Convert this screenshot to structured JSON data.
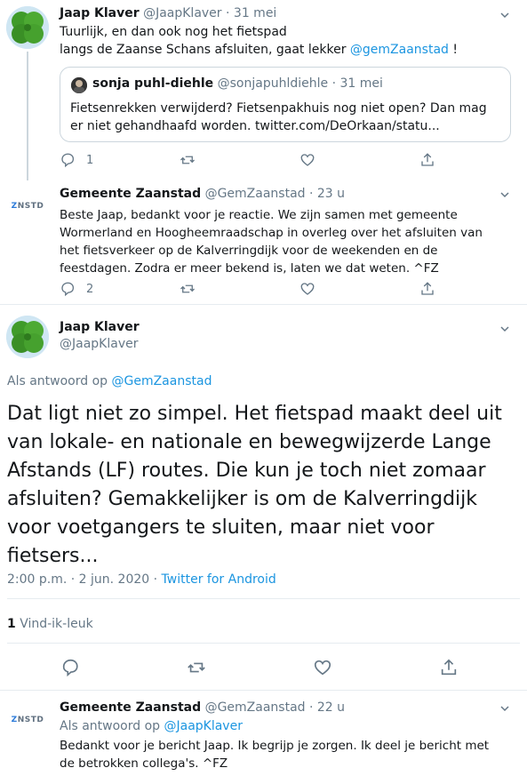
{
  "tweets": [
    {
      "name": "Jaap Klaver",
      "handle": "@JaapKlaver",
      "time": "· 31 mei",
      "lines": [
        "Tuurlijk, en dan ook nog het fietspad",
        "langs de Zaanse Schans afsluiten, gaat lekker "
      ],
      "mention": "@gemZaanstad",
      "suffix": " !",
      "quote": {
        "name": "sonja puhl-diehle",
        "handle": "@sonjapuhldiehle",
        "time": "· 31 mei",
        "lines": [
          "Fietsenrekken verwijderd? Fietsenpakhuis nog niet open? Dan mag",
          "er niet gehandhaafd worden. twitter.com/DeOrkaan/statu..."
        ]
      },
      "reply_count": "1"
    },
    {
      "name": "Gemeente Zaanstad",
      "handle": "@GemZaanstad",
      "time": "· 23 u",
      "avatar_text_a": "Z",
      "avatar_text_b": "NSTD",
      "lines": [
        "Beste Jaap, bedankt voor je reactie. We zijn samen met gemeente",
        "Wormerland en Hoogheemraadschap in overleg over het afsluiten van",
        "het fietsverkeer op de Kalverringdijk voor de weekenden en de",
        "feestdagen. Zodra er meer bekend is, laten we dat weten. ^FZ"
      ],
      "reply_count": "2"
    }
  ],
  "main": {
    "name": "Jaap Klaver",
    "handle": "@JaapKlaver",
    "reply_to_prefix": "Als antwoord op ",
    "reply_to": "@GemZaanstad",
    "lines": [
      "Dat ligt niet zo simpel. Het fietspad maakt deel uit",
      "van lokale- en nationale en bewegwijzerde Lange",
      "Afstands (LF) routes. Die kun je toch niet zomaar",
      "afsluiten? Gemakkelijker is om de Kalverringdijk",
      "voor voetgangers te sluiten, maar niet voor",
      "fietsers..."
    ],
    "timestamp": "2:00 p.m. · 2 jun. 2020 · ",
    "source": "Twitter for Android",
    "likes_count": "1",
    "likes_label": " Vind-ik-leuk"
  },
  "reply": {
    "name": "Gemeente Zaanstad",
    "handle": "@GemZaanstad",
    "time": "· 22 u",
    "reply_to_prefix": "Als antwoord op ",
    "reply_to": "@JaapKlaver",
    "lines": [
      "Bedankt voor je bericht Jaap. Ik begrijp je zorgen. Ik deel je bericht met",
      "de betrokken collega's. ^FZ"
    ]
  },
  "colors": {
    "link": "#1b95e0",
    "muted": "#657786",
    "divider": "#e6ecf0"
  },
  "icons": [
    "reply-icon",
    "retweet-icon",
    "like-icon",
    "share-icon",
    "chevron-down-icon"
  ]
}
